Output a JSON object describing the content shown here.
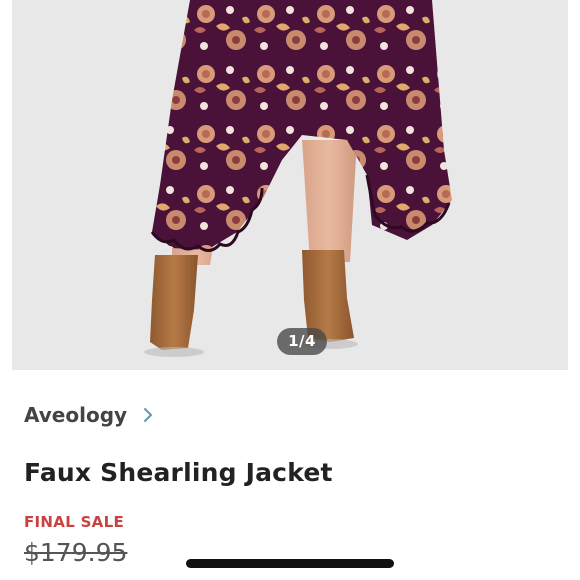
{
  "product_image": {
    "subject": "model-wearing-floral-ruffle-skirt-and-tan-ankle-boots",
    "background_color": "#e8e8e8",
    "skirt_color": "#4a1238",
    "floral_color": "#d99a7a",
    "boot_color": "#a06a3c",
    "counter": "1/4"
  },
  "brand": {
    "name": "Aveology",
    "chevron_icon": "chevron-right-icon",
    "chevron_color": "#5a9ab5"
  },
  "product": {
    "title": "Faux Shearling Jacket",
    "sale_label": "FINAL SALE",
    "sale_color": "#c94141",
    "price": "$179.95"
  }
}
